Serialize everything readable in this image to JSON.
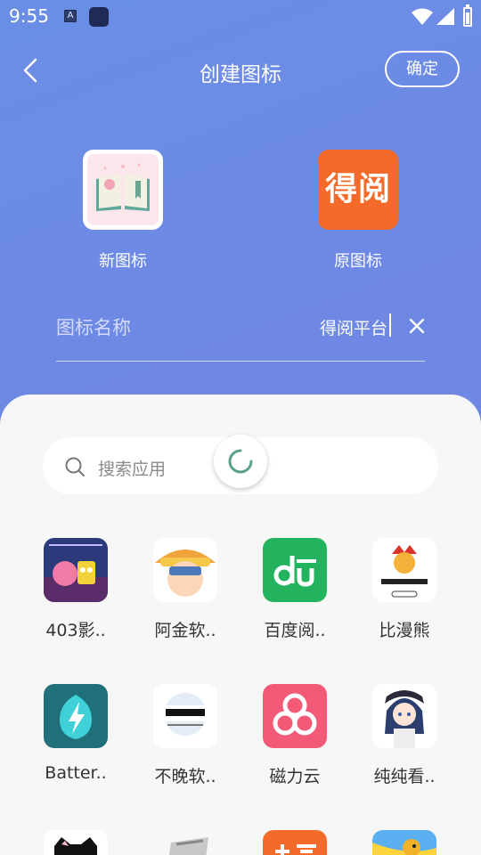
{
  "status_bar": {
    "time": "9:55",
    "notif_icon_letter": "A"
  },
  "header": {
    "title": "创建图标",
    "confirm_label": "确定"
  },
  "icons": {
    "new_caption": "新图标",
    "original_caption": "原图标",
    "original_icon_text": "得阅"
  },
  "name_field": {
    "label": "图标名称",
    "value": "得阅平台"
  },
  "search": {
    "placeholder": "搜索应用"
  },
  "apps": [
    {
      "label": "403影..",
      "icon": "movie-poster-icon",
      "color": "#2b3a7a"
    },
    {
      "label": "阿金软..",
      "icon": "cartoon-boy-icon",
      "color": "#ffffff"
    },
    {
      "label": "百度阅..",
      "icon": "du-logo-icon",
      "color": "#23b25e"
    },
    {
      "label": "比漫熊",
      "icon": "bear-logo-icon",
      "color": "#ffffff"
    },
    {
      "label": "Batter..",
      "icon": "battery-bolt-icon",
      "color": "#20707a"
    },
    {
      "label": "不晚软..",
      "icon": "buwan-logo-icon",
      "color": "#ffffff"
    },
    {
      "label": "磁力云",
      "icon": "magnet-cloud-icon",
      "color": "#f35a77"
    },
    {
      "label": "纯纯看..",
      "icon": "anime-girl-icon",
      "color": "#ffffff"
    },
    {
      "label": "",
      "icon": "cat-app-icon",
      "color": "#ffffff"
    },
    {
      "label": "",
      "icon": "book-app-icon",
      "color": "#f7f7f7"
    },
    {
      "label": "",
      "icon": "orange-app-icon",
      "color": "#f36a2b"
    },
    {
      "label": "",
      "icon": "fish-app-icon",
      "color": "#ffd43a"
    }
  ]
}
